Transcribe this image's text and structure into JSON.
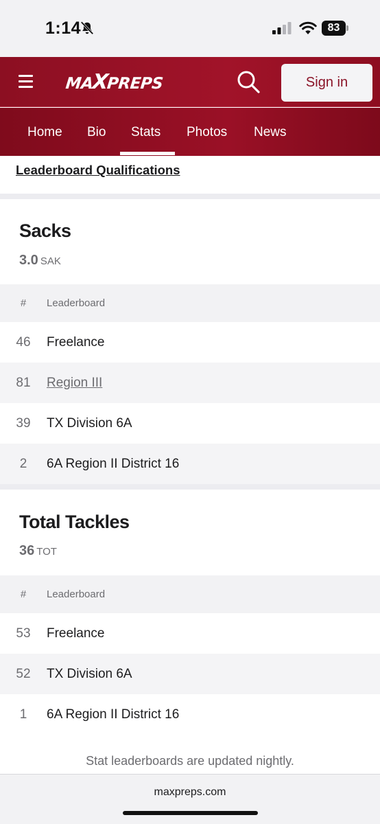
{
  "status_bar": {
    "time": "1:14",
    "battery": "83",
    "icons": [
      "bell-muted-icon",
      "signal-icon",
      "wifi-icon",
      "battery-icon"
    ]
  },
  "header": {
    "logo_parts": [
      "MA",
      "X",
      "PREPS"
    ],
    "sign_in_label": "Sign in",
    "icons": [
      "menu-icon",
      "search-icon"
    ],
    "brand_color": "#9b1128"
  },
  "tabs": [
    {
      "label": "Home",
      "active": false
    },
    {
      "label": "Bio",
      "active": false
    },
    {
      "label": "Stats",
      "active": true
    },
    {
      "label": "Photos",
      "active": false
    },
    {
      "label": "News",
      "active": false
    }
  ],
  "qualifications_link": "Leaderboard Qualifications",
  "sections": [
    {
      "title": "Sacks",
      "value": "3.0",
      "unit": "SAK",
      "columns": {
        "rank": "#",
        "name": "Leaderboard"
      },
      "rows": [
        {
          "rank": "46",
          "name": "Freelance"
        },
        {
          "rank": "81",
          "name": "Region III"
        },
        {
          "rank": "39",
          "name": "TX Division 6A"
        },
        {
          "rank": "2",
          "name": "6A Region II District 16"
        }
      ]
    },
    {
      "title": "Total Tackles",
      "value": "36",
      "unit": "TOT",
      "columns": {
        "rank": "#",
        "name": "Leaderboard"
      },
      "rows": [
        {
          "rank": "53",
          "name": "Freelance"
        },
        {
          "rank": "52",
          "name": "TX Division 6A"
        },
        {
          "rank": "1",
          "name": "6A Region II District 16"
        }
      ]
    }
  ],
  "footer_note": "Stat leaderboards are updated nightly.",
  "url": "maxpreps.com"
}
